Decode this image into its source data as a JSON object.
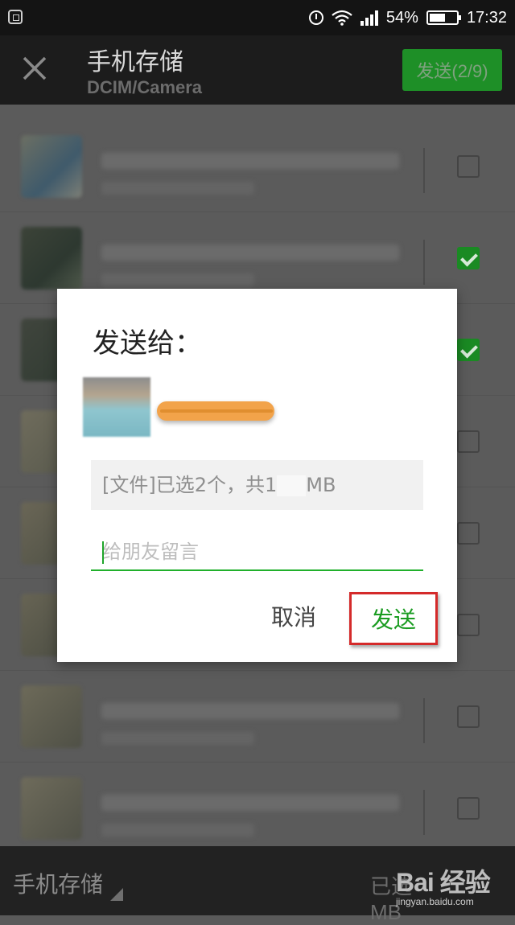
{
  "status_bar": {
    "battery": "54%",
    "time": "17:32",
    "icons": [
      "screenshot-icon",
      "alarm-icon",
      "wifi-icon",
      "signal-icon",
      "battery-icon"
    ]
  },
  "header": {
    "title": "手机存储",
    "path": "DCIM/Camera",
    "send_label": "发送(2/9)",
    "accent_color": "#1e8f27"
  },
  "file_list": {
    "rows": [
      {
        "checked": false
      },
      {
        "checked": true
      },
      {
        "checked": true
      },
      {
        "checked": false
      },
      {
        "checked": false
      },
      {
        "checked": false
      },
      {
        "checked": false
      },
      {
        "checked": false
      }
    ]
  },
  "dialog": {
    "title": "发送给：",
    "file_info": "[文件]已选2个，共1",
    "file_size_unit": "MB",
    "message_placeholder": "给朋友留言",
    "cancel_label": "取消",
    "send_label": "发送"
  },
  "bottom_bar": {
    "storage_label": "手机存储",
    "selected_text": "已选",
    "selected_unit": "MB"
  },
  "watermark": {
    "main": "Bai 经验",
    "sub": "jingyan.baidu.com"
  }
}
